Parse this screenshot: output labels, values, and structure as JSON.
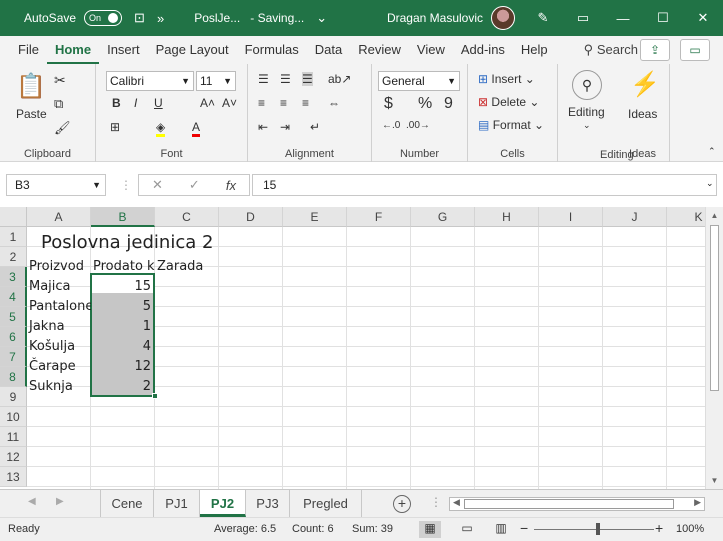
{
  "titlebar": {
    "autosave_label": "AutoSave",
    "autosave_state": "On",
    "filename": "PoslJe...",
    "status": "Saving...",
    "user": "Dragan Masulovic",
    "minimize": "—",
    "maximize": "☐",
    "close": "✕"
  },
  "menu": {
    "tabs": [
      "File",
      "Home",
      "Insert",
      "Page Layout",
      "Formulas",
      "Data",
      "Review",
      "View",
      "Add-ins",
      "Help"
    ],
    "active": "Home",
    "search": "Search"
  },
  "ribbon": {
    "clipboard": {
      "label": "Clipboard",
      "paste": "Paste"
    },
    "font": {
      "label": "Font",
      "family": "Calibri",
      "size": "11",
      "bold": "B",
      "italic": "I",
      "underline": "U",
      "grow": "A˄",
      "shrink": "A˅"
    },
    "alignment": {
      "label": "Alignment"
    },
    "number": {
      "label": "Number",
      "format": "General",
      "currency": "$",
      "percent": "%",
      "comma": "9"
    },
    "cells": {
      "label": "Cells",
      "insert": "Insert",
      "delete": "Delete",
      "format": "Format"
    },
    "editing": {
      "label": "Editing"
    },
    "ideas": {
      "label": "Ideas",
      "button": "Ideas"
    }
  },
  "formula_bar": {
    "name_box": "B3",
    "fx": "fx",
    "value": "15"
  },
  "columns": [
    "A",
    "B",
    "C",
    "D",
    "E",
    "F",
    "G",
    "H",
    "I",
    "J",
    "K"
  ],
  "rows": [
    "1",
    "2",
    "3",
    "4",
    "5",
    "6",
    "7",
    "8",
    "9",
    "10",
    "11",
    "12",
    "13"
  ],
  "sheet": {
    "title": "Poslovna jedinica 2",
    "headers": [
      "Proizvod",
      "Prodato komada",
      "Zarada"
    ],
    "products": [
      "Majica",
      "Pantalone",
      "Jakna",
      "Košulja",
      "Čarape",
      "Suknja"
    ],
    "sold": [
      "15",
      "5",
      "1",
      "4",
      "12",
      "2"
    ]
  },
  "sheet_tabs": [
    "Cene",
    "PJ1",
    "PJ2",
    "PJ3",
    "Pregled"
  ],
  "active_sheet": "PJ2",
  "status": {
    "mode": "Ready",
    "average": "Average: 6.5",
    "count": "Count: 6",
    "sum": "Sum: 39",
    "zoom": "100%"
  },
  "colors": {
    "accent": "#217346",
    "selection": "#c6c6c6"
  }
}
